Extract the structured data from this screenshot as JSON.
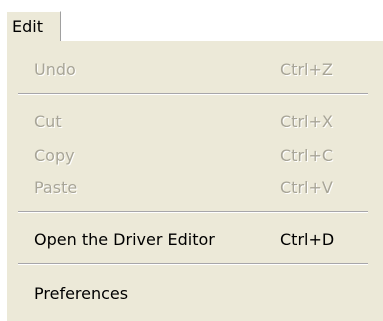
{
  "menubar": {
    "edit_label": "Edit"
  },
  "menu": {
    "items": [
      {
        "label": "Undo",
        "shortcut": "Ctrl+Z",
        "enabled": false
      },
      {
        "label": "Cut",
        "shortcut": "Ctrl+X",
        "enabled": false
      },
      {
        "label": "Copy",
        "shortcut": "Ctrl+C",
        "enabled": false
      },
      {
        "label": "Paste",
        "shortcut": "Ctrl+V",
        "enabled": false
      },
      {
        "label": "Open the Driver Editor",
        "shortcut": "Ctrl+D",
        "enabled": true
      },
      {
        "label": "Preferences",
        "shortcut": "",
        "enabled": true
      }
    ]
  },
  "colors": {
    "menu_background": "#ece9d8",
    "disabled_text": "#a8a597",
    "enabled_text": "#000000"
  }
}
